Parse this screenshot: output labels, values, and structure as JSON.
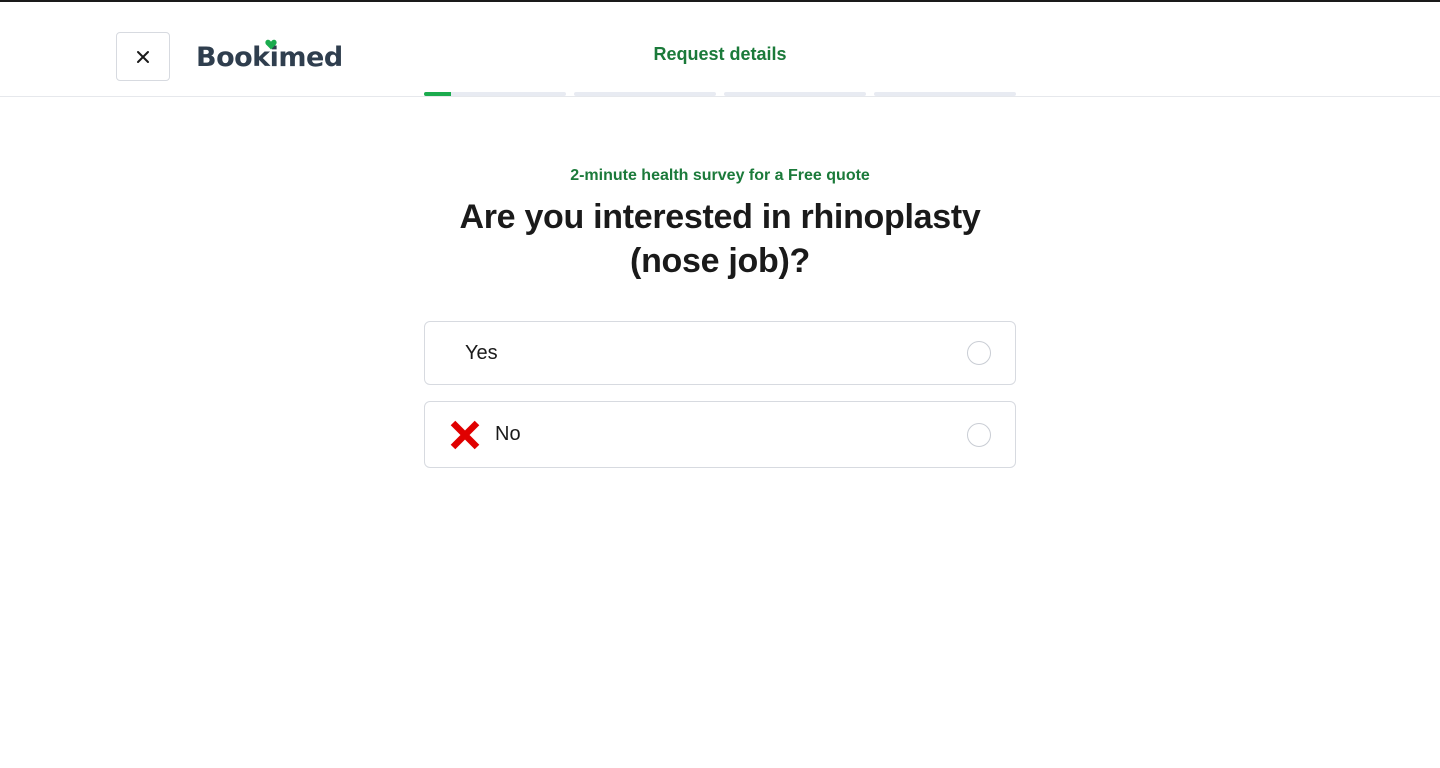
{
  "header": {
    "logo_text": "Bookimed",
    "title": "Request details",
    "close_icon": "close-icon"
  },
  "progress": {
    "segments": [
      {
        "filled": 0.19
      },
      {
        "filled": 0
      },
      {
        "filled": 0
      },
      {
        "filled": 0
      }
    ],
    "accent": "#1bab4e"
  },
  "survey": {
    "subtitle": "2-minute health survey for a Free quote",
    "question": "Are you interested in rhinoplasty (nose job)?",
    "options": [
      {
        "label": "Yes",
        "icon": "none"
      },
      {
        "label": "No",
        "icon": "cross-mark-icon"
      }
    ]
  },
  "colors": {
    "brand_green": "#1b7a3a",
    "logo_dark": "#2f3e4e",
    "cross_red": "#e00000"
  }
}
